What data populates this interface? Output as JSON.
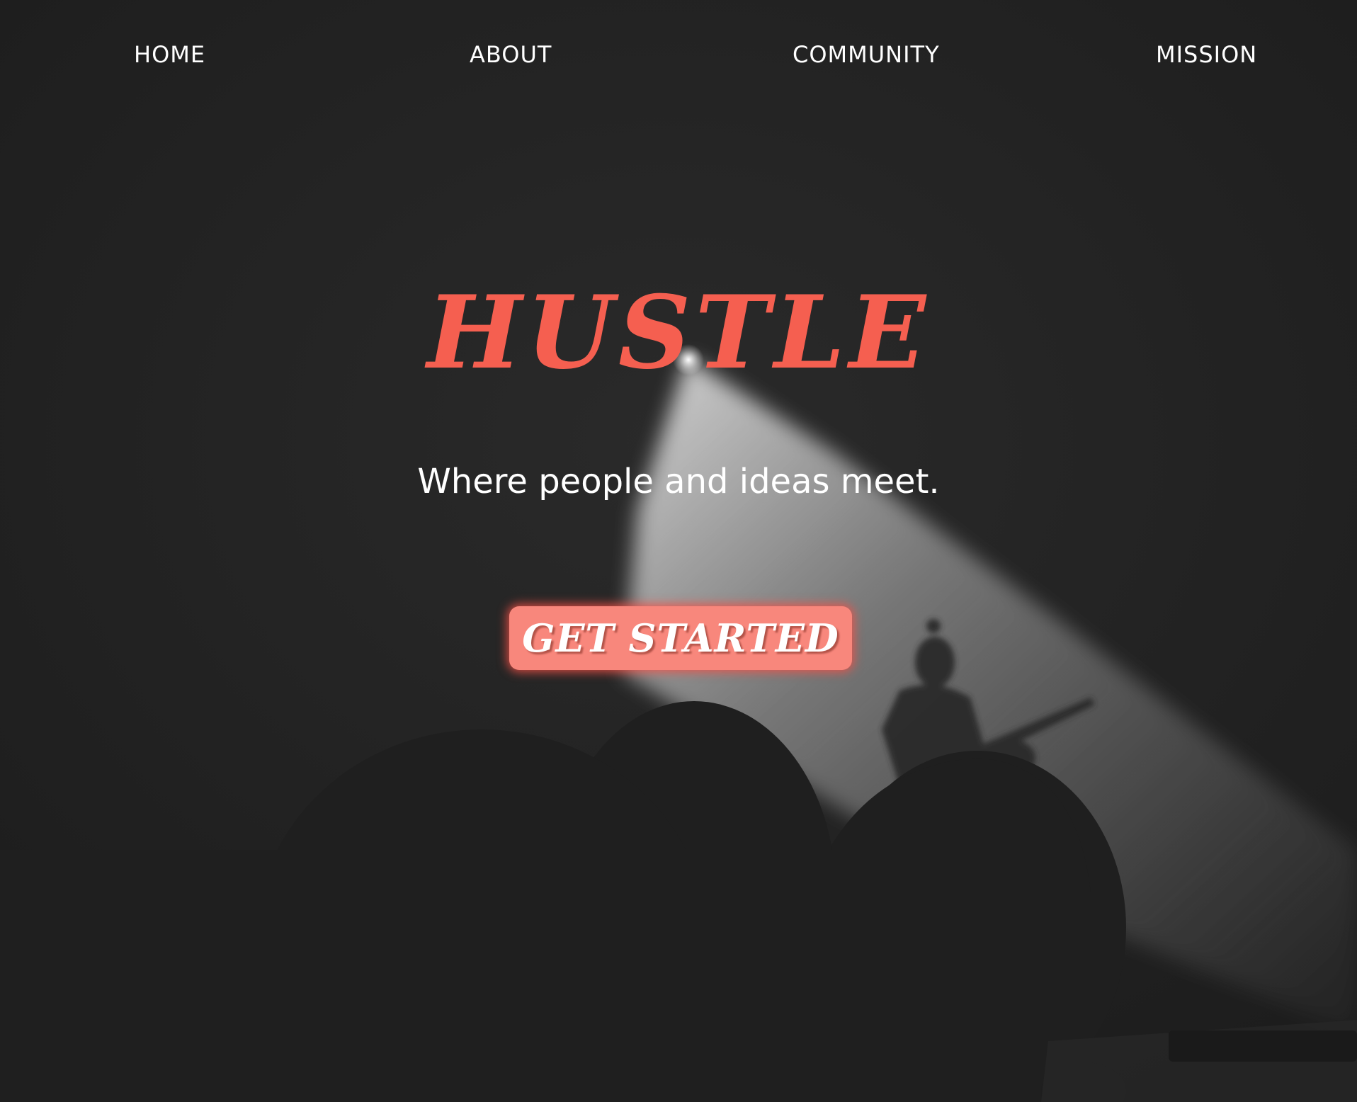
{
  "nav": {
    "items": [
      {
        "label": "HOME"
      },
      {
        "label": "ABOUT"
      },
      {
        "label": "COMMUNITY"
      },
      {
        "label": "MISSION"
      }
    ]
  },
  "hero": {
    "title": "HUSTLE",
    "tagline": "Where people and ideas meet.",
    "cta_label": "GET STARTED"
  },
  "colors": {
    "background": "#212121",
    "accent": "#f55f50",
    "button": "#f8877c",
    "text": "#ffffff"
  },
  "icons": {
    "background_image": "concert-spotlight-guitarist-photo"
  }
}
